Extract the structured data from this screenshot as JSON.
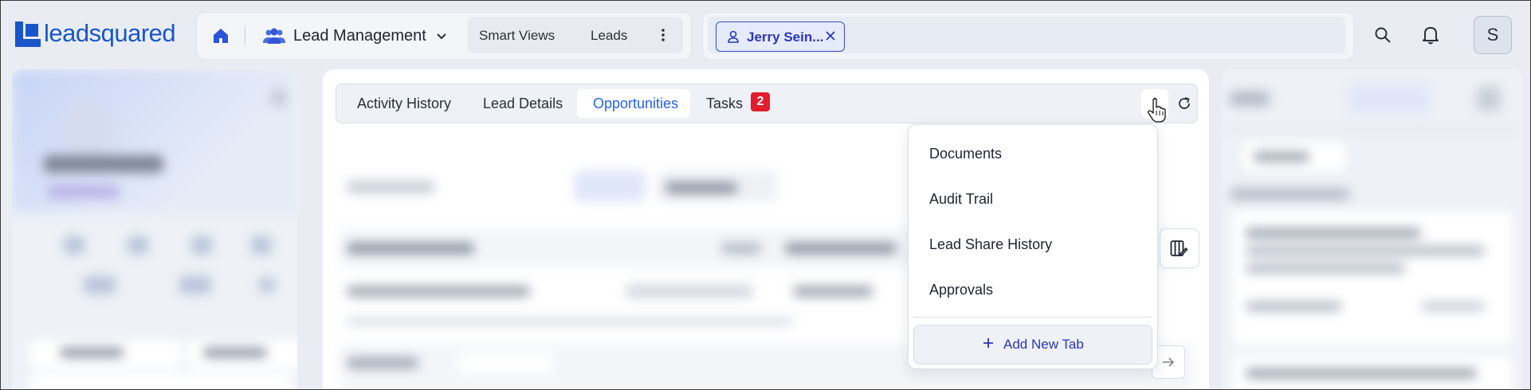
{
  "app": {
    "logo_text": "leadsquared",
    "module_label": "Lead Management",
    "nav_tabs": [
      "Smart Views",
      "Leads"
    ]
  },
  "search": {
    "chip_label": "Jerry Sein..."
  },
  "user": {
    "avatar_initial": "S"
  },
  "lead_tabs": {
    "items": [
      "Activity History",
      "Lead Details",
      "Opportunities",
      "Tasks"
    ],
    "active": "Opportunities",
    "tasks_badge": "2"
  },
  "more_menu": {
    "items": [
      "Documents",
      "Audit Trail",
      "Lead Share History",
      "Approvals"
    ],
    "add_label": "Add New Tab"
  },
  "icons": {
    "home": "home-icon",
    "module": "users-icon",
    "search": "search-icon",
    "notifications": "bell-icon",
    "refresh": "refresh-icon",
    "more": "kebab-icon",
    "columns": "manage-columns-icon",
    "next": "arrow-right-icon"
  },
  "colors": {
    "brand": "#1a56c9",
    "accent": "#2563eb",
    "chip_border": "#3b4ac7",
    "badge": "#e11d2e"
  }
}
